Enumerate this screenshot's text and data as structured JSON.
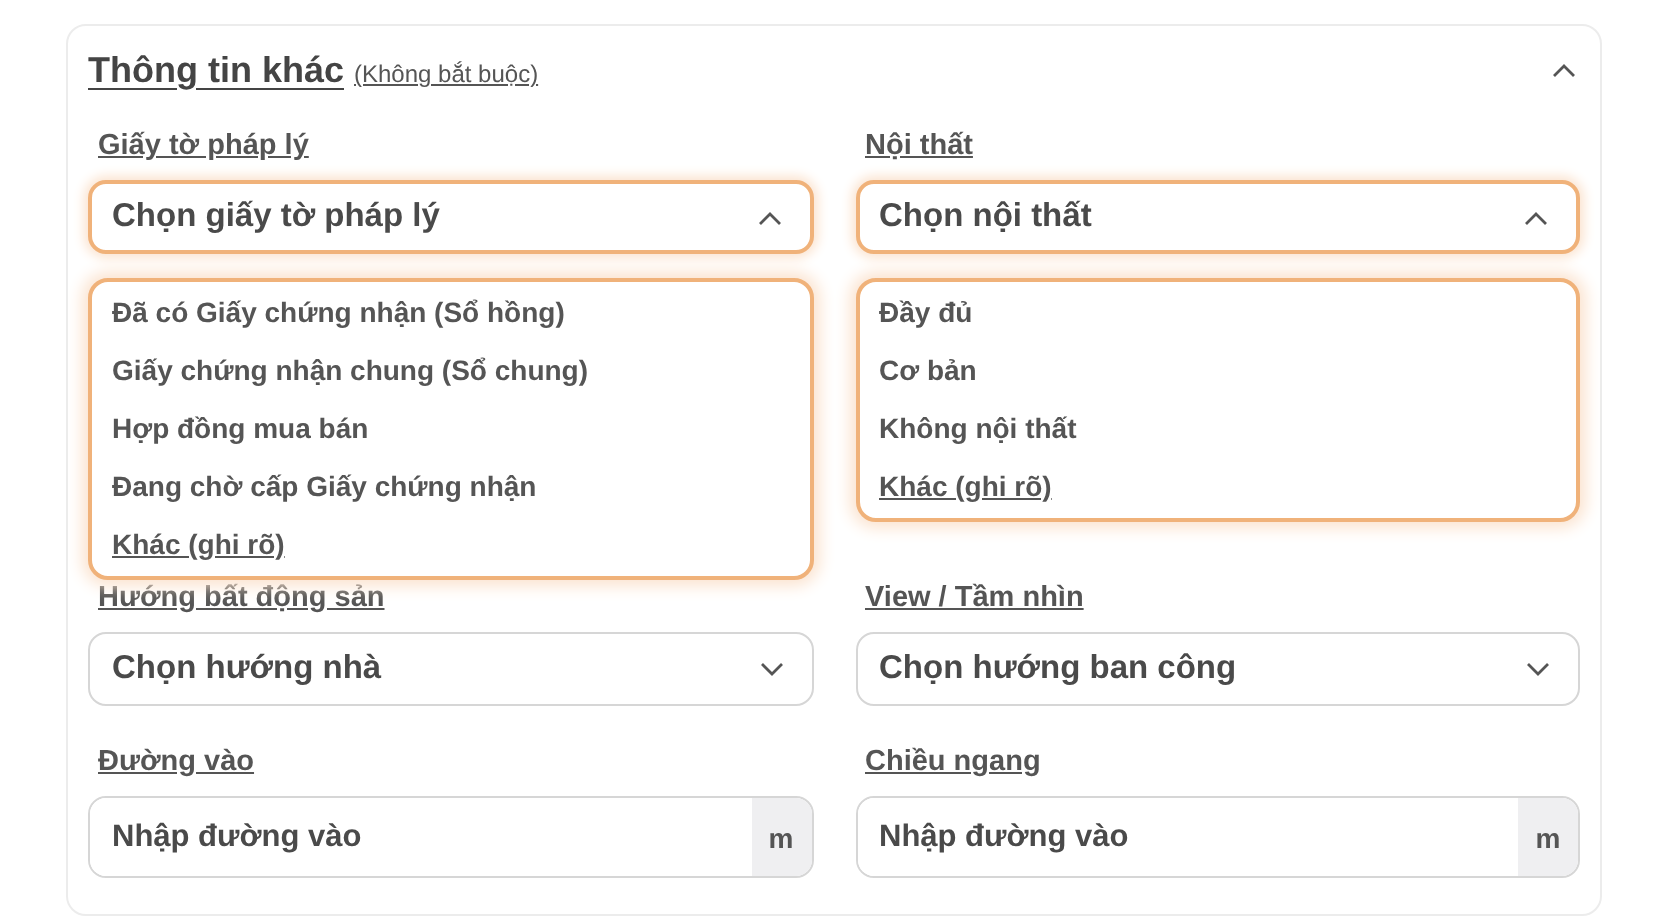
{
  "section": {
    "title": "Thông tin khác",
    "note": "(Không bắt buộc)",
    "expanded": true
  },
  "fields": [
    {
      "kind": "select",
      "label": "Giấy tờ pháp lý",
      "placeholder": "Chọn giấy tờ pháp lý",
      "open": true,
      "options": [
        {
          "label": "Đã có Giấy chứng nhận (Sổ hồng)",
          "underlined": false
        },
        {
          "label": "Giấy chứng nhận chung (Sổ chung)",
          "underlined": false
        },
        {
          "label": "Hợp đồng mua bán",
          "underlined": false
        },
        {
          "label": "Đang chờ cấp Giấy chứng nhận",
          "underlined": false
        },
        {
          "label": "Khác (ghi rõ)",
          "underlined": true
        }
      ]
    },
    {
      "kind": "select",
      "label": "Nội thất",
      "placeholder": "Chọn nội thất",
      "open": true,
      "options": [
        {
          "label": "Đầy đủ",
          "underlined": false
        },
        {
          "label": "Cơ bản",
          "underlined": false
        },
        {
          "label": "Không nội thất",
          "underlined": false
        },
        {
          "label": "Khác (ghi rõ)",
          "underlined": true
        }
      ]
    },
    {
      "kind": "select",
      "label": "Hướng bất động sản",
      "placeholder": "Chọn hướng nhà",
      "open": false
    },
    {
      "kind": "select",
      "label": "View / Tầm nhìn",
      "placeholder": "Chọn hướng ban công",
      "open": false
    },
    {
      "kind": "input",
      "label": "Đường vào",
      "placeholder": "Nhập đường vào",
      "unit": "m"
    },
    {
      "kind": "input",
      "label": "Chiều ngang",
      "placeholder": "Nhập đường vào",
      "unit": "m"
    }
  ]
}
